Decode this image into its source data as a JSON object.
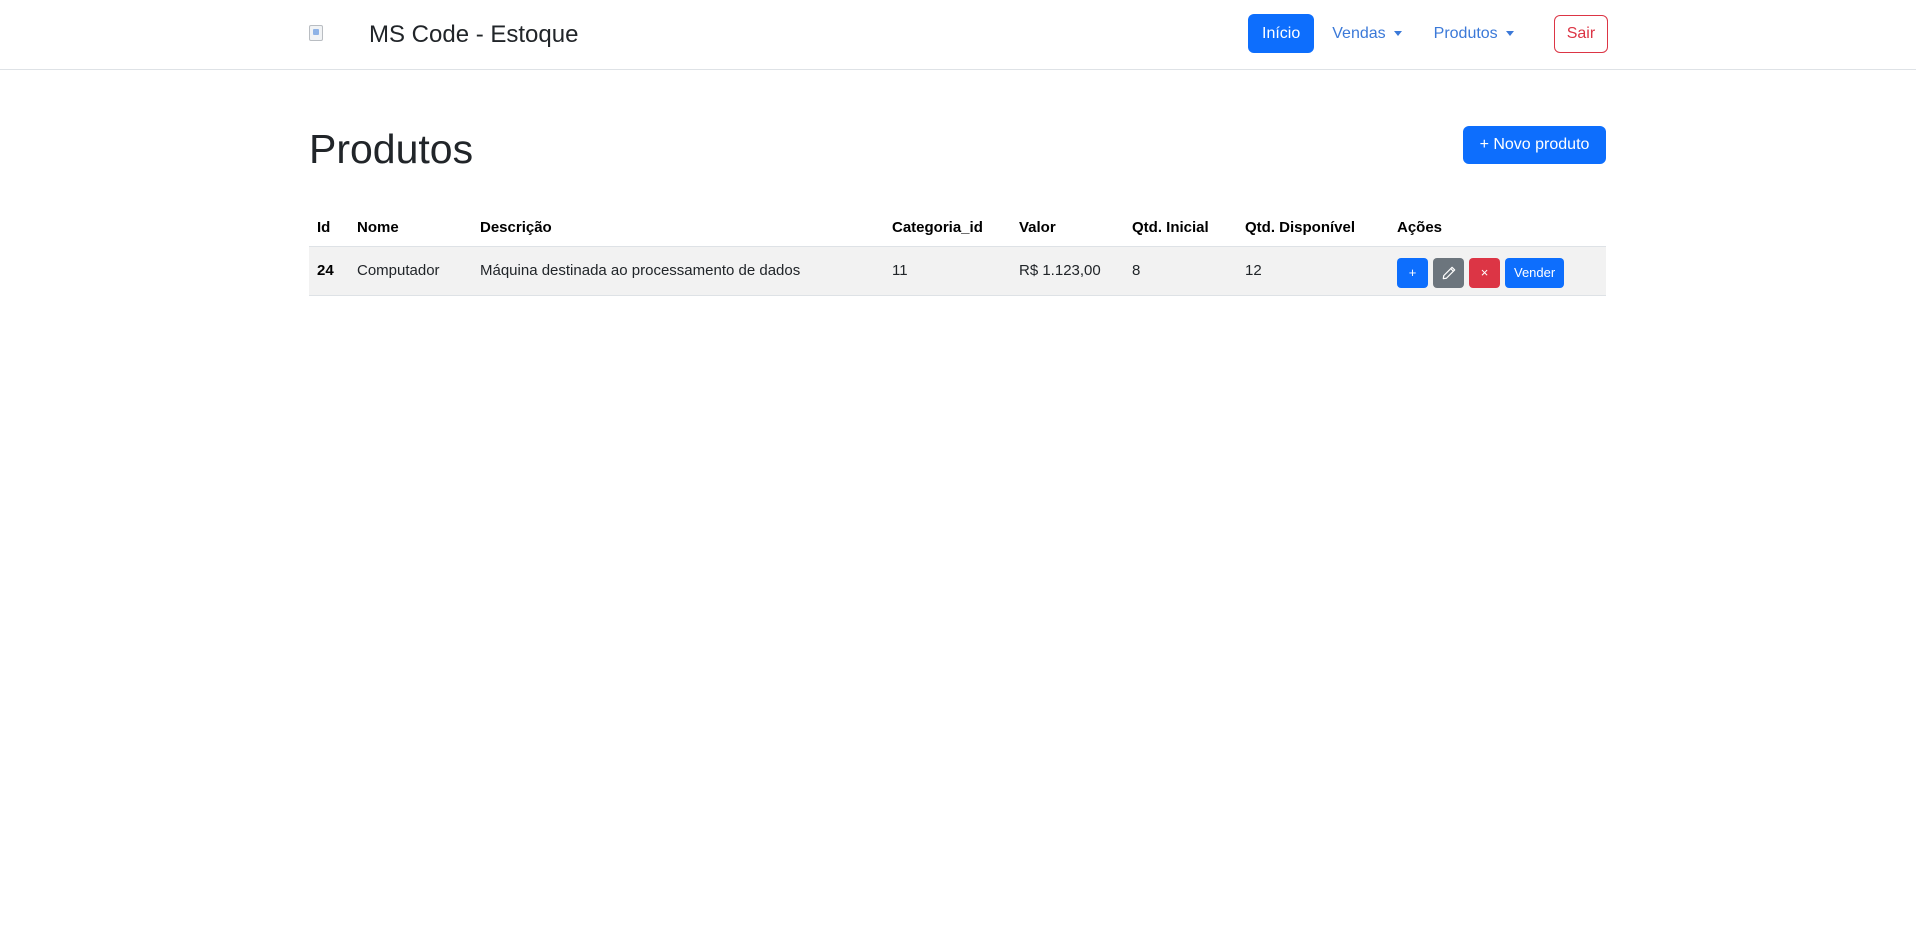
{
  "header": {
    "brand": "MS Code - Estoque",
    "nav": {
      "home": "Início",
      "sales": "Vendas",
      "products": "Produtos",
      "logout": "Sair"
    }
  },
  "main": {
    "title": "Produtos",
    "new_button": "+ Novo produto",
    "table": {
      "columns": [
        "Id",
        "Nome",
        "Descrição",
        "Categoria_id",
        "Valor",
        "Qtd. Inicial",
        "Qtd. Disponível",
        "Ações"
      ],
      "rows": [
        {
          "id": "24",
          "name": "Computador",
          "description": "Máquina destinada ao processamento de dados",
          "category_id": "11",
          "value": "R$ 1.123,00",
          "initial_qty": "8",
          "available_qty": "12",
          "actions": {
            "add": "+",
            "edit_icon": "pencil-icon",
            "delete": "×",
            "sell": "Vender"
          }
        }
      ]
    }
  },
  "colors": {
    "primary": "#0d6efd",
    "danger": "#dc3545",
    "secondary": "#6c757d",
    "link": "#3b79d8"
  }
}
